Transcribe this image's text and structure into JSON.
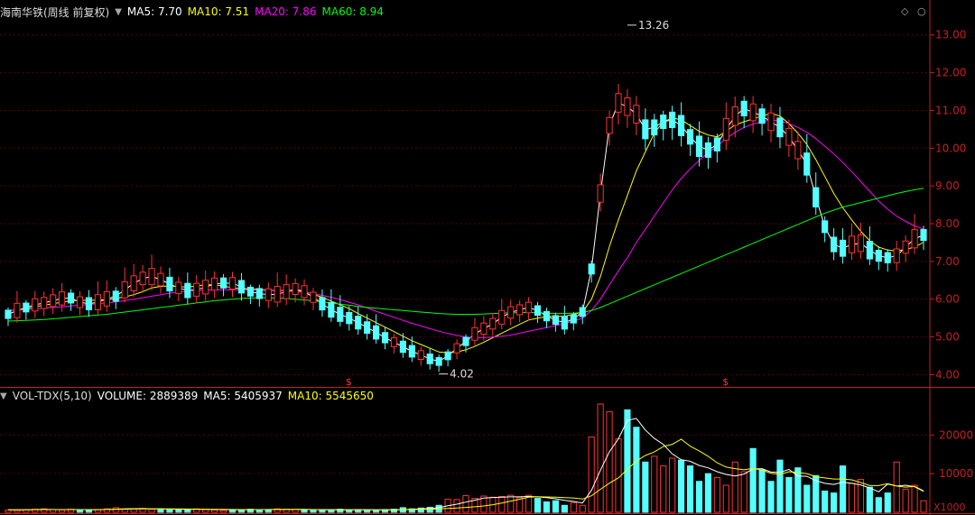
{
  "header": {
    "title": "海南华铁(周线 前复权)",
    "ma_items": [
      {
        "label": "MA5: 7.70",
        "color": "#ffffff"
      },
      {
        "label": "MA10: 7.51",
        "color": "#ffff00"
      },
      {
        "label": "MA20: 7.86",
        "color": "#ff00ff"
      },
      {
        "label": "MA60: 8.94",
        "color": "#00ff00"
      }
    ]
  },
  "volume_header": {
    "indicator": "VOL-TDX(5,10)",
    "items": [
      {
        "label": "VOLUME: 2889389",
        "color": "#ffffff"
      },
      {
        "label": "MA5: 5405937",
        "color": "#ffffff"
      },
      {
        "label": "MA10: 5545650",
        "color": "#ffff00"
      }
    ]
  },
  "colors": {
    "up": "#ff3232",
    "down": "#54ffff",
    "grid": "#5a0000",
    "axis": "#c81e1e"
  },
  "chart_data": [
    {
      "type": "candlestick",
      "title": "海南华铁(周线 前复权)",
      "ylim": [
        3.7,
        13.4
      ],
      "y_ticks": [
        "4.00",
        "5.00",
        "6.00",
        "7.00",
        "8.00",
        "9.00",
        "10.00",
        "11.00",
        "12.00",
        "13.00"
      ],
      "annotations": [
        {
          "text": "13.26",
          "value": 13.26,
          "bar_index": 69
        },
        {
          "text": "4.02",
          "value": 4.02,
          "bar_index": 48
        }
      ],
      "markers": [
        {
          "text": "$",
          "bar_index": 38
        },
        {
          "text": "$",
          "bar_index": 80
        }
      ],
      "series": [
        {
          "name": "MA5",
          "values": [
            5.6,
            5.7,
            5.78,
            5.85,
            5.9,
            5.96,
            6.02,
            6.03,
            5.92,
            5.88,
            5.92,
            6.01,
            6.08,
            6.25,
            6.42,
            6.55,
            6.6,
            6.52,
            6.4,
            6.3,
            6.23,
            6.25,
            6.32,
            6.4,
            6.43,
            6.42,
            6.33,
            6.2,
            6.15,
            6.12,
            6.13,
            6.2,
            6.27,
            6.2,
            6.05,
            5.88,
            5.72,
            5.6,
            5.5,
            5.38,
            5.25,
            5.12,
            4.98,
            4.86,
            4.74,
            4.62,
            4.52,
            4.42,
            4.35,
            4.5,
            4.7,
            4.88,
            5.08,
            5.22,
            5.35,
            5.52,
            5.65,
            5.72,
            5.78,
            5.7,
            5.55,
            5.45,
            5.38,
            5.48,
            5.66,
            6.8,
            8.8,
            10.6,
            11.2,
            11.1,
            10.9,
            10.5,
            10.55,
            10.7,
            10.75,
            10.6,
            10.3,
            10.05,
            9.95,
            10.1,
            10.5,
            10.85,
            11.05,
            10.95,
            10.85,
            10.7,
            10.55,
            10.3,
            9.95,
            9.58,
            8.7,
            7.92,
            7.45,
            7.35,
            7.45,
            7.48,
            7.3,
            7.15,
            7.1,
            7.15,
            7.38,
            7.6,
            7.7
          ]
        },
        {
          "name": "MA10",
          "values": [
            5.7,
            5.72,
            5.75,
            5.8,
            5.84,
            5.88,
            5.92,
            5.96,
            5.97,
            5.97,
            5.98,
            5.99,
            6.02,
            6.06,
            6.12,
            6.2,
            6.3,
            6.34,
            6.35,
            6.33,
            6.32,
            6.35,
            6.38,
            6.38,
            6.35,
            6.3,
            6.28,
            6.27,
            6.26,
            6.24,
            6.23,
            6.23,
            6.23,
            6.2,
            6.13,
            6.05,
            5.95,
            5.85,
            5.75,
            5.62,
            5.5,
            5.38,
            5.26,
            5.14,
            5.02,
            4.9,
            4.8,
            4.7,
            4.6,
            4.58,
            4.6,
            4.66,
            4.75,
            4.86,
            4.98,
            5.1,
            5.22,
            5.34,
            5.45,
            5.5,
            5.54,
            5.55,
            5.55,
            5.6,
            5.66,
            6.0,
            6.6,
            7.4,
            8.1,
            8.75,
            9.4,
            9.9,
            10.4,
            10.7,
            10.8,
            10.75,
            10.6,
            10.45,
            10.35,
            10.3,
            10.45,
            10.62,
            10.7,
            10.78,
            10.85,
            10.92,
            10.85,
            10.65,
            10.4,
            10.1,
            9.7,
            9.25,
            8.8,
            8.42,
            8.1,
            7.8,
            7.55,
            7.38,
            7.3,
            7.28,
            7.32,
            7.38,
            7.51
          ]
        },
        {
          "name": "MA20",
          "values": [
            5.7,
            5.71,
            5.72,
            5.74,
            5.76,
            5.78,
            5.8,
            5.82,
            5.84,
            5.86,
            5.88,
            5.9,
            5.93,
            5.96,
            6.0,
            6.04,
            6.08,
            6.12,
            6.16,
            6.19,
            6.21,
            6.23,
            6.24,
            6.25,
            6.25,
            6.25,
            6.25,
            6.25,
            6.24,
            6.23,
            6.22,
            6.21,
            6.2,
            6.18,
            6.15,
            6.1,
            6.05,
            5.99,
            5.92,
            5.85,
            5.77,
            5.68,
            5.6,
            5.52,
            5.44,
            5.36,
            5.29,
            5.22,
            5.15,
            5.09,
            5.04,
            5.0,
            4.98,
            4.98,
            5.0,
            5.02,
            5.05,
            5.1,
            5.15,
            5.2,
            5.25,
            5.3,
            5.35,
            5.42,
            5.5,
            5.7,
            6.0,
            6.38,
            6.75,
            7.1,
            7.5,
            7.85,
            8.2,
            8.55,
            8.9,
            9.2,
            9.45,
            9.68,
            9.88,
            10.05,
            10.25,
            10.42,
            10.55,
            10.64,
            10.7,
            10.75,
            10.72,
            10.65,
            10.55,
            10.42,
            10.25,
            10.05,
            9.85,
            9.62,
            9.38,
            9.12,
            8.86,
            8.6,
            8.38,
            8.2,
            8.06,
            7.94,
            7.86
          ]
        },
        {
          "name": "MA60",
          "values": [
            5.42,
            5.43,
            5.44,
            5.45,
            5.46,
            5.48,
            5.5,
            5.52,
            5.54,
            5.56,
            5.58,
            5.6,
            5.63,
            5.66,
            5.69,
            5.72,
            5.75,
            5.78,
            5.81,
            5.84,
            5.87,
            5.9,
            5.93,
            5.96,
            5.98,
            6.0,
            6.02,
            6.03,
            6.04,
            6.04,
            6.03,
            6.02,
            6.0,
            5.98,
            5.96,
            5.93,
            5.9,
            5.87,
            5.84,
            5.81,
            5.78,
            5.76,
            5.74,
            5.72,
            5.7,
            5.68,
            5.66,
            5.64,
            5.62,
            5.61,
            5.6,
            5.6,
            5.6,
            5.61,
            5.62,
            5.63,
            5.64,
            5.64,
            5.65,
            5.64,
            5.63,
            5.62,
            5.62,
            5.63,
            5.65,
            5.7,
            5.78,
            5.88,
            5.98,
            6.08,
            6.18,
            6.28,
            6.38,
            6.48,
            6.58,
            6.68,
            6.78,
            6.88,
            6.98,
            7.08,
            7.18,
            7.28,
            7.38,
            7.48,
            7.58,
            7.68,
            7.78,
            7.88,
            7.98,
            8.08,
            8.18,
            8.28,
            8.36,
            8.44,
            8.5,
            8.56,
            8.62,
            8.68,
            8.74,
            8.8,
            8.85,
            8.9,
            8.94
          ]
        }
      ]
    },
    {
      "type": "bar",
      "title": "VOL-TDX(5,10)",
      "unit": "X1000",
      "ylim": [
        0,
        28000
      ],
      "y_ticks": [
        "10000",
        "20000"
      ],
      "values": [
        600,
        500,
        700,
        800,
        900,
        700,
        600,
        800,
        500,
        600,
        700,
        900,
        1200,
        800,
        900,
        1000,
        800,
        900,
        700,
        600,
        800,
        900,
        700,
        600,
        500,
        600,
        700,
        800,
        600,
        700,
        900,
        800,
        700,
        600,
        500,
        600,
        700,
        800,
        600,
        700,
        600,
        500,
        700,
        800,
        1200,
        900,
        1100,
        1300,
        1800,
        3400,
        3300,
        4300,
        3600,
        4200,
        3900,
        4100,
        4400,
        3800,
        4400,
        3600,
        2700,
        3000,
        1800,
        2500,
        1800,
        19500,
        28000,
        26000,
        19000,
        26500,
        22000,
        13000,
        14500,
        12000,
        14000,
        13500,
        12000,
        8000,
        10000,
        9000,
        7000,
        13000,
        10500,
        16500,
        11000,
        8000,
        13500,
        9000,
        11500,
        7000,
        9500,
        5500,
        5000,
        12000,
        7500,
        8500,
        6500,
        3800,
        5000,
        13000,
        6000,
        7000,
        3000
      ],
      "series": [
        {
          "name": "MA5",
          "values": [
            650,
            640,
            660,
            700,
            740,
            730,
            700,
            710,
            690,
            680,
            660,
            720,
            820,
            900,
            940,
            960,
            920,
            880,
            840,
            800,
            780,
            760,
            740,
            720,
            700,
            680,
            660,
            680,
            700,
            720,
            740,
            760,
            760,
            740,
            700,
            660,
            620,
            620,
            640,
            660,
            680,
            660,
            640,
            640,
            700,
            780,
            880,
            1000,
            1200,
            1680,
            2100,
            2640,
            3120,
            3680,
            3820,
            3900,
            4000,
            4000,
            4100,
            4000,
            3800,
            3500,
            3100,
            2800,
            2400,
            5700,
            10900,
            15700,
            19000,
            23800,
            24300,
            21300,
            19100,
            17600,
            15100,
            13600,
            13200,
            12100,
            11500,
            10500,
            9800,
            9400,
            9900,
            11200,
            11300,
            10400,
            10300,
            11100,
            9400,
            9300,
            8200,
            7500,
            7200,
            7800,
            7500,
            7100,
            6300,
            5300,
            7300,
            6800,
            7000,
            6600,
            5406
          ]
        },
        {
          "name": "MA10",
          "values": [
            640,
            640,
            650,
            670,
            690,
            700,
            710,
            720,
            710,
            700,
            700,
            720,
            760,
            800,
            830,
            860,
            870,
            880,
            880,
            860,
            840,
            820,
            790,
            760,
            740,
            720,
            700,
            700,
            700,
            700,
            700,
            710,
            720,
            720,
            710,
            700,
            690,
            680,
            670,
            670,
            670,
            660,
            650,
            650,
            670,
            700,
            740,
            790,
            870,
            1000,
            1130,
            1260,
            1420,
            1630,
            1950,
            2380,
            2900,
            3380,
            3900,
            4040,
            3960,
            3920,
            3800,
            3720,
            3440,
            4280,
            5940,
            7530,
            8920,
            11130,
            13250,
            14700,
            15600,
            17000,
            17600,
            18900,
            17100,
            15900,
            14500,
            12800,
            11700,
            11300,
            11000,
            11350,
            10900,
            10100,
            9800,
            10500,
            10300,
            10000,
            9200,
            8900,
            8600,
            8600,
            8400,
            7700,
            6900,
            6900,
            7400,
            6800,
            6500,
            6700,
            5546
          ]
        }
      ]
    }
  ]
}
